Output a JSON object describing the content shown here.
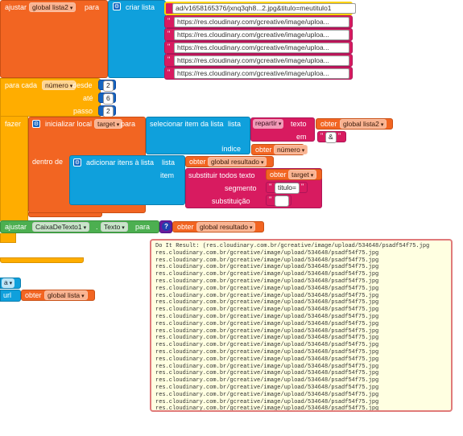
{
  "set_list2": {
    "set_label": "ajustar",
    "var_name": "global lista2",
    "to_label": "para",
    "create_list_label": "criar lista",
    "items": [
      "ad/v1658165376/jxnq3qh8...2.jpg&titulo=meutitulo1",
      "https://res.cloudinary.com/gcreative/image/uploa...",
      "https://res.cloudinary.com/gcreative/image/uploa...",
      "https://res.cloudinary.com/gcreative/image/uploa...",
      "https://res.cloudinary.com/gcreative/image/uploa...",
      "https://res.cloudinary.com/gcreative/image/uploa..."
    ]
  },
  "for_range": {
    "label": "para cada",
    "var": "número",
    "from_label": "desde",
    "from": "2",
    "to_label": "até",
    "to": "6",
    "step_label": "passo",
    "step": "2",
    "do_label": "fazer"
  },
  "local_init": {
    "label": "inicializar local",
    "var": "target",
    "to_label": "para",
    "in_label": "dentro de"
  },
  "select_item": {
    "label": "selecionar item da lista",
    "list_label": "lista",
    "index_label": "índice",
    "split_label": "repartir",
    "text_label": "texto",
    "at_label": "em",
    "separator": "&",
    "get_label": "obter",
    "get_var_list2": "global lista2",
    "get_var_number": "número"
  },
  "add_items": {
    "label": "adicionar itens à lista",
    "list_label": "lista",
    "item_label": "item",
    "get_label": "obter",
    "get_var_result": "global resultado",
    "replace_label": "substituir todos texto",
    "get_var_target": "target",
    "segment_label": "segmento",
    "segment_value": "titulo=",
    "replacement_label": "substituição",
    "replacement_value": ""
  },
  "set_textbox": {
    "set_label": "ajustar",
    "component": "CaixaDeTexto1",
    "dot": ".",
    "property": "Texto",
    "to_label": "para",
    "get_label": "obter",
    "get_var": "global resultado"
  },
  "side_blocks": {
    "a_label": "a",
    "url_label": "url",
    "get_label": "obter",
    "get_var": "global lista"
  },
  "tooltip": {
    "header": "Do It Result: (res.cloudinary.com.br/gcreative/image/upload/534648/psadf54f75.jpg",
    "line": "res.cloudinary.com.br/gcreative/image/upload/534648/psadf54f75.jpg",
    "line_count": 23
  },
  "colors": {
    "orange": "#f26522",
    "blue": "#0fa0dc",
    "pink": "#d81b60",
    "yellow": "#ffad00",
    "green": "#4caf50",
    "tooltip_bg": "#ffffe1",
    "tooltip_border": "#e07a7a"
  }
}
